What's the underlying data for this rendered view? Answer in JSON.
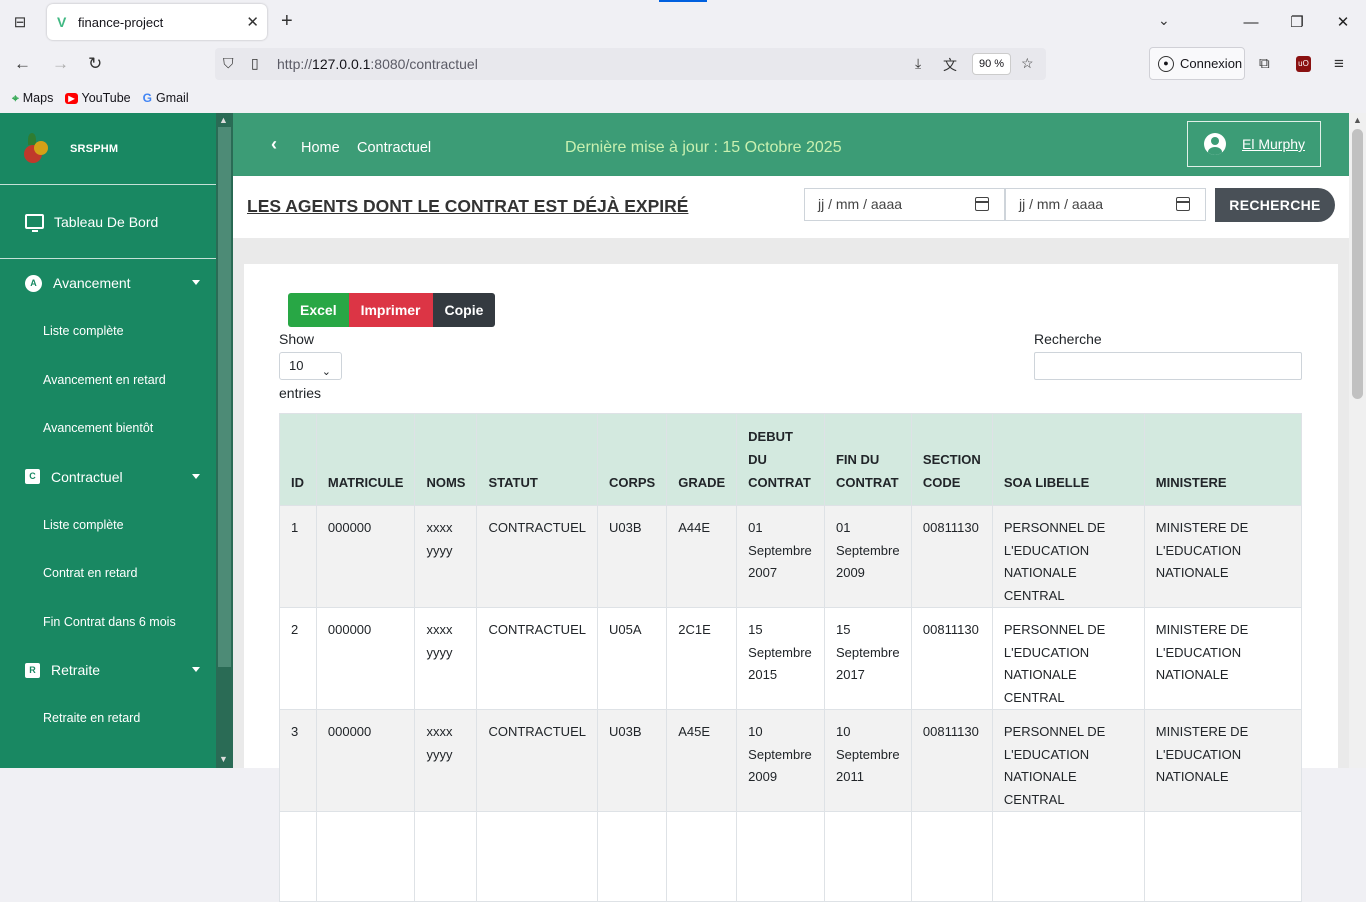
{
  "browser": {
    "tab_title": "finance-project",
    "url_prefix": "http://",
    "url_host": "127.0.0.1",
    "url_rest": ":8080/contractuel",
    "zoom": "90 %",
    "account_label": "Connexion",
    "bookmarks": [
      {
        "label": "Maps",
        "icon": "maps-icon"
      },
      {
        "label": "YouTube",
        "icon": "youtube-icon"
      },
      {
        "label": "Gmail",
        "icon": "google-icon"
      }
    ]
  },
  "sidebar": {
    "brand": "SRSPHM",
    "dashboard": "Tableau De Bord",
    "sections": [
      {
        "badge": "A",
        "label": "Avancement",
        "items": [
          "Liste complète",
          "Avancement en retard",
          "Avancement bientôt"
        ]
      },
      {
        "badge": "C",
        "label": "Contractuel",
        "items": [
          "Liste complète",
          "Contrat en retard",
          "Fin Contrat dans 6 mois"
        ]
      },
      {
        "badge": "R",
        "label": "Retraite",
        "items": [
          "Retraite en retard"
        ]
      }
    ]
  },
  "header": {
    "crumb_home": "Home",
    "crumb_current": "Contractuel",
    "last_update": "Dernière mise à jour : 15 Octobre 2025",
    "user_name": "El Murphy"
  },
  "filter": {
    "title": "LES AGENTS DONT LE CONTRAT EST DÉJÀ EXPIRÉ",
    "date_from_placeholder": "jj / mm / aaaa",
    "date_to_placeholder": "jj / mm / aaaa",
    "search_button": "RECHERCHE"
  },
  "table_tools": {
    "excel": "Excel",
    "print": "Imprimer",
    "copy": "Copie",
    "show_label": "Show",
    "show_value": "10",
    "entries_label": "entries",
    "search_label": "Recherche"
  },
  "table": {
    "columns": [
      "ID",
      "MATRICULE",
      "NOMS",
      "STATUT",
      "CORPS",
      "GRADE",
      "DEBUT DU CONTRAT",
      "FIN DU CONTRAT",
      "SECTION CODE",
      "SOA LIBELLE",
      "MINISTERE"
    ],
    "rows": [
      [
        "1",
        "000000",
        "xxxx yyyy",
        "CONTRACTUEL",
        "U03B",
        "A44E",
        "01 Septembre 2007",
        "01 Septembre 2009",
        "00811130",
        "PERSONNEL DE L'EDUCATION NATIONALE CENTRAL",
        "MINISTERE DE L'EDUCATION NATIONALE"
      ],
      [
        "2",
        "000000",
        "xxxx yyyy",
        "CONTRACTUEL",
        "U05A",
        "2C1E",
        "15 Septembre 2015",
        "15 Septembre 2017",
        "00811130",
        "PERSONNEL DE L'EDUCATION NATIONALE CENTRAL",
        "MINISTERE DE L'EDUCATION NATIONALE"
      ],
      [
        "3",
        "000000",
        "xxxx yyyy",
        "CONTRACTUEL",
        "U03B",
        "A45E",
        "10 Septembre 2009",
        "10 Septembre 2011",
        "00811130",
        "PERSONNEL DE L'EDUCATION NATIONALE CENTRAL",
        "MINISTERE DE L'EDUCATION NATIONALE"
      ]
    ]
  }
}
